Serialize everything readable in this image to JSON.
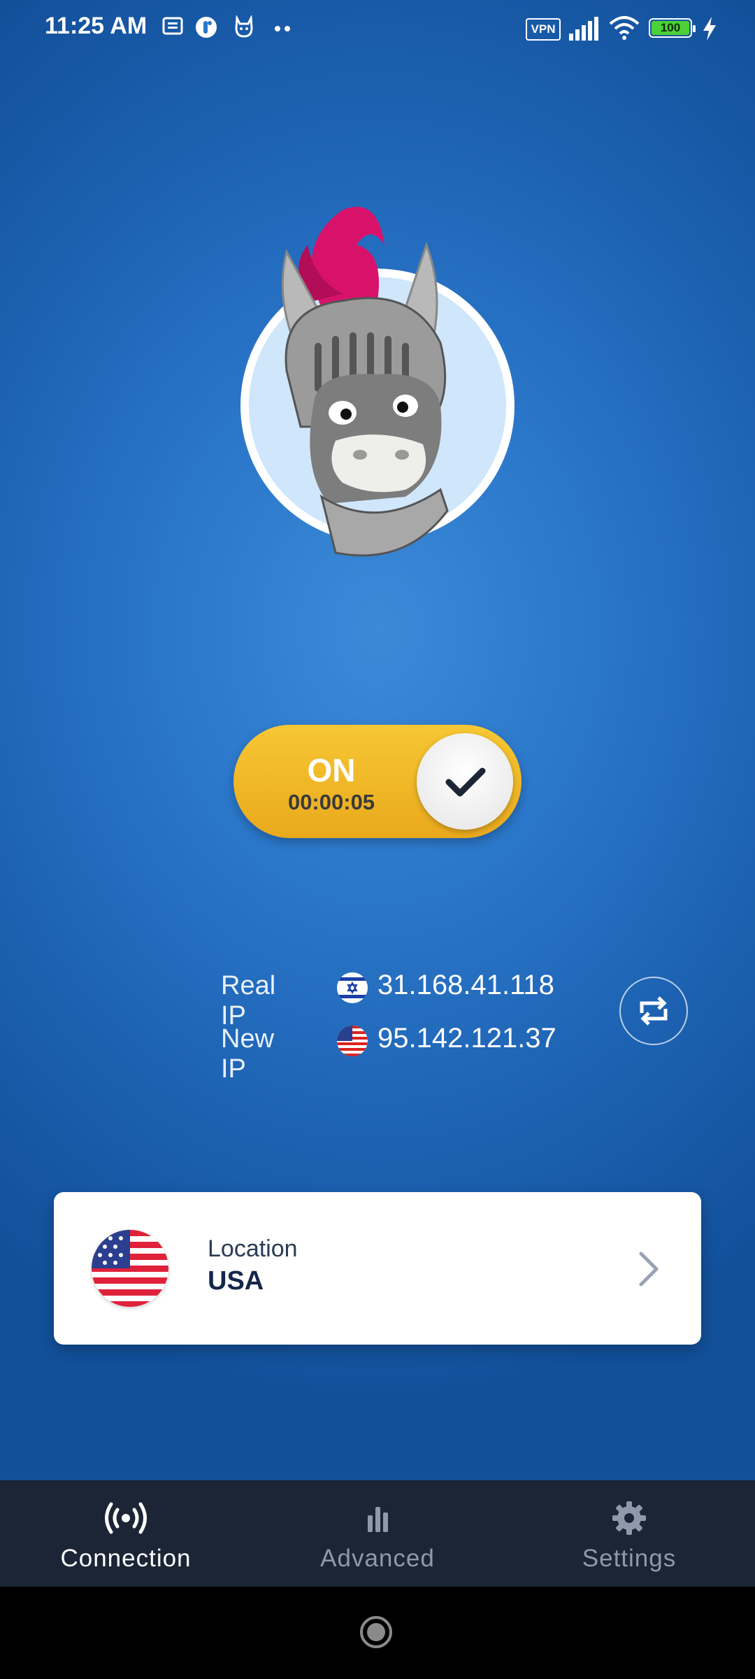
{
  "status_bar": {
    "time": "11:25 AM",
    "vpn_badge": "VPN",
    "battery_level": "100",
    "icons": [
      "news-icon",
      "app-icon",
      "cat-icon",
      "more-dots-icon",
      "vpn-key-icon",
      "signal-icon",
      "wifi-icon",
      "battery-icon",
      "charging-icon"
    ]
  },
  "toggle": {
    "state_label": "ON",
    "timer": "00:00:05"
  },
  "ip_info": {
    "real_ip_label": "Real IP",
    "real_ip_value": "31.168.41.118",
    "real_ip_flag": "israel-flag-icon",
    "new_ip_label": "New IP",
    "new_ip_value": "95.142.121.37",
    "new_ip_flag": "usa-flag-icon"
  },
  "location": {
    "caption": "Location",
    "value": "USA"
  },
  "bottom_nav": {
    "items": [
      {
        "label": "Connection",
        "icon": "broadcast-icon",
        "active": true
      },
      {
        "label": "Advanced",
        "icon": "bar-chart-icon",
        "active": false
      },
      {
        "label": "Settings",
        "icon": "gear-icon",
        "active": false
      }
    ]
  },
  "colors": {
    "background_blue": "#2a76c9",
    "toggle_yellow": "#f2bb2a",
    "nav_bg": "#1b2536",
    "card_text": "#15274a"
  }
}
